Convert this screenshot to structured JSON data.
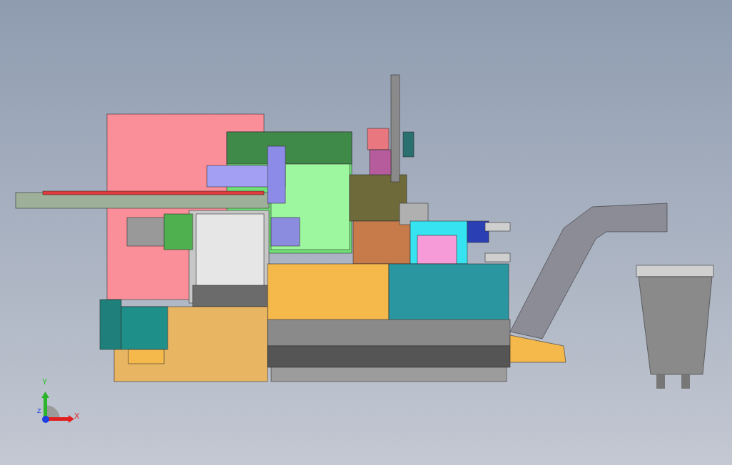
{
  "viewport": {
    "axis_triad": {
      "y_label": "Y",
      "z_label": "Z",
      "x_label": "X"
    }
  }
}
